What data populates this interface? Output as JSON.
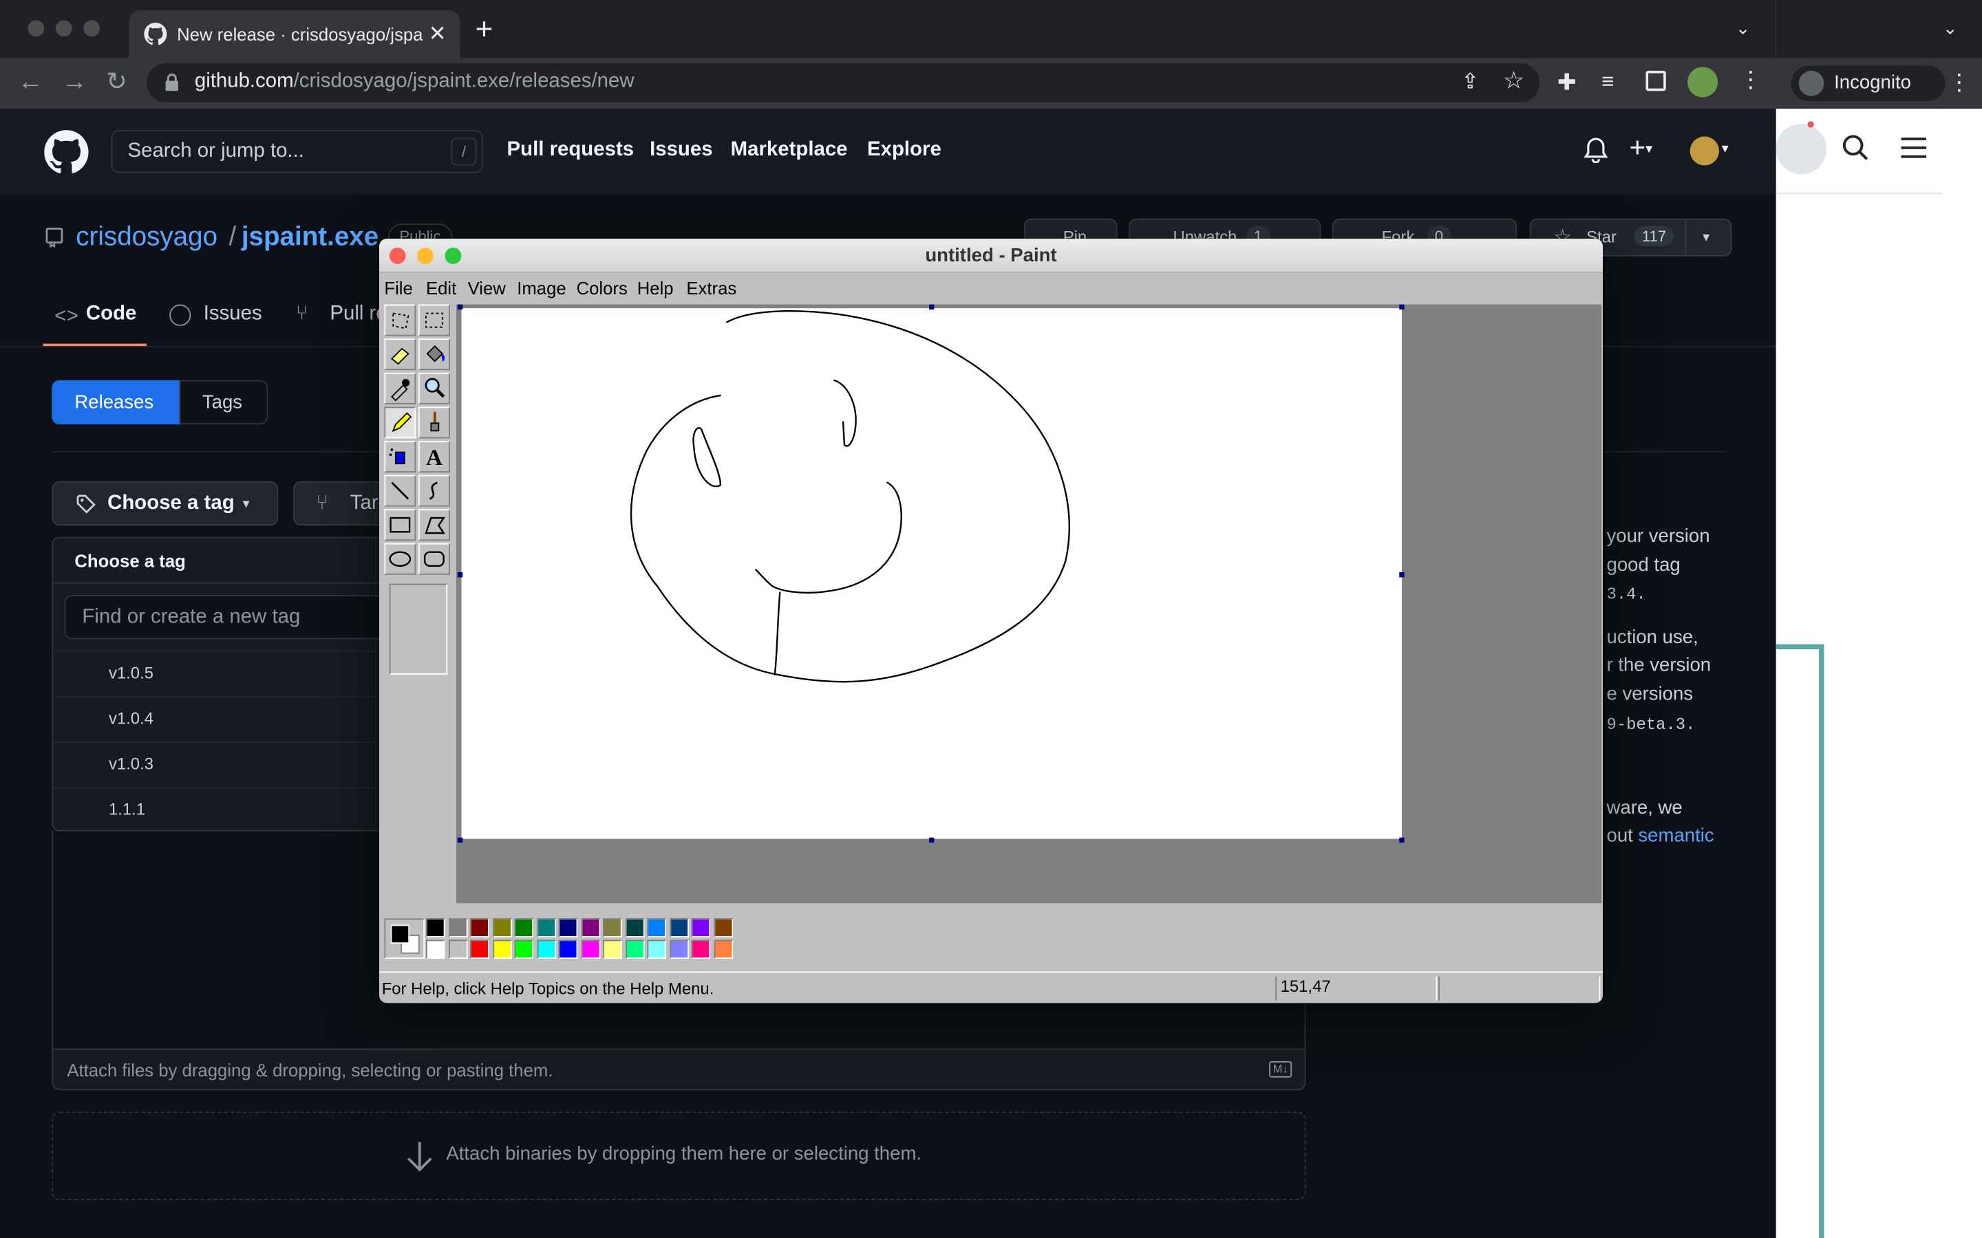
{
  "browser": {
    "tab_title": "New release · crisdosyago/jspaint.exe/releases/new",
    "url_host": "github.com",
    "url_path": "/crisdosyago/jspaint.exe/releases/new",
    "incognito_label": "Incognito"
  },
  "github": {
    "search_placeholder": "Search or jump to...",
    "search_shortcut": "/",
    "nav": [
      "Pull requests",
      "Issues",
      "Marketplace",
      "Explore"
    ],
    "owner": "crisdosyago",
    "separator": "/",
    "repo": "jspaint.exe",
    "visibility": "Public",
    "pin_label": "Pin",
    "watch_label": "Unwatch",
    "watch_count": "1",
    "fork_label": "Fork",
    "fork_count": "0",
    "star_label": "Star",
    "star_count": "117",
    "repo_tabs": [
      "Code",
      "Issues",
      "Pull requests"
    ],
    "subnav": {
      "releases": "Releases",
      "tags": "Tags"
    },
    "choose_tag": "Choose a tag",
    "target": "Target",
    "dropdown_title": "Choose a tag",
    "tag_input_placeholder": "Find or create a new tag",
    "tags": [
      "v1.0.5",
      "v1.0.4",
      "v1.0.3",
      "1.1.1"
    ],
    "sidebar_text": [
      "your version",
      "good tag",
      "3.4.",
      "uction use,",
      "r the version",
      "e versions",
      "9-beta.3.",
      "ware, we",
      "out",
      "semantic"
    ],
    "attach_files": "Attach files by dragging & dropping, selecting or pasting them.",
    "attach_binaries": "Attach binaries by dropping them here or selecting them.",
    "markdown_badge": "M↓"
  },
  "paint": {
    "title": "untitled - Paint",
    "menu": [
      "File",
      "Edit",
      "View",
      "Image",
      "Colors",
      "Help",
      "Extras"
    ],
    "status_help": "For Help, click Help Topics on the Help Menu.",
    "status_coords": "151,47",
    "primary_color": "#000000",
    "secondary_color": "#ffffff",
    "palette_top": [
      "#000000",
      "#808080",
      "#800000",
      "#808000",
      "#008000",
      "#008080",
      "#000080",
      "#800080",
      "#808040",
      "#004040",
      "#0080ff",
      "#004080",
      "#8000ff",
      "#804000"
    ],
    "palette_bottom": [
      "#ffffff",
      "#c0c0c0",
      "#ff0000",
      "#ffff00",
      "#00ff00",
      "#00ffff",
      "#0000ff",
      "#ff00ff",
      "#ffff80",
      "#00ff80",
      "#80ffff",
      "#8080ff",
      "#ff0080",
      "#ff8040"
    ],
    "tools": [
      "free-form-select",
      "rect-select",
      "eraser",
      "fill",
      "pick-color",
      "magnifier",
      "pencil",
      "brush",
      "airbrush",
      "text",
      "line",
      "curve",
      "rectangle",
      "polygon",
      "ellipse",
      "rounded-rectangle"
    ],
    "selected_tool": "pencil"
  }
}
